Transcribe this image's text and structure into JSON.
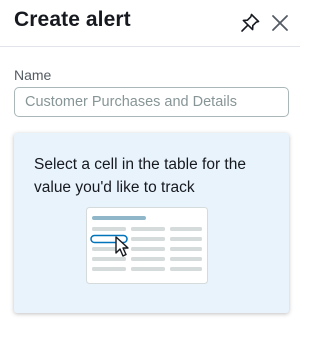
{
  "header": {
    "title": "Create alert",
    "pin_icon": "pin-icon",
    "close_icon": "close-icon"
  },
  "form": {
    "name_label": "Name",
    "name_value": "",
    "name_placeholder": "Customer Purchases and Details"
  },
  "hint": {
    "text": "Select a cell in the table for the value you'd like to track",
    "illustration_icon": "table-select-cell-illustration",
    "cursor_icon": "mouse-pointer-icon"
  },
  "colors": {
    "hint_background": "#e9f3fc",
    "selected_cell": "#0073bb",
    "header_bar": "#8fb7c9",
    "table_rows": "#d5dbdb"
  }
}
